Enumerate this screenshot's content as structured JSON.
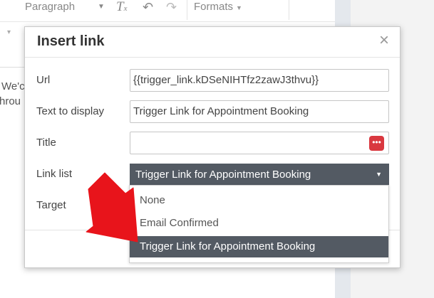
{
  "toolbar": {
    "paragraph_label": "Paragraph",
    "formats_label": "Formats",
    "clear_format_icon": "clear-formatting-icon",
    "undo_icon": "undo-icon",
    "redo_icon": "redo-icon"
  },
  "background": {
    "text_line1": "We'c",
    "text_line2": "hrou"
  },
  "dialog": {
    "title": "Insert link",
    "close_glyph": "×",
    "url": {
      "label": "Url",
      "value": "{{trigger_link.kDSeNIHTfz2zawJ3thvu}}"
    },
    "text_to_display": {
      "label": "Text to display",
      "value": "Trigger Link for Appointment Booking"
    },
    "title_field": {
      "label": "Title",
      "value": ""
    },
    "link_list": {
      "label": "Link list",
      "selected": "Trigger Link for Appointment Booking"
    },
    "target": {
      "label": "Target"
    }
  },
  "menu": {
    "options": [
      "None",
      "Email Confirmed",
      "Trigger Link for Appointment Booking"
    ],
    "selected_index": 2
  },
  "colors": {
    "select_bg": "#535a63",
    "browse_button": "#d9383f",
    "arrow": "#e8141b"
  }
}
